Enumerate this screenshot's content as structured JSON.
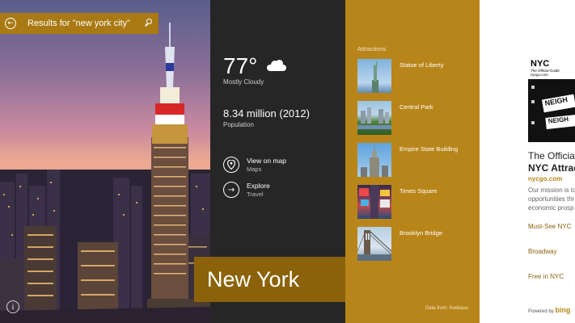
{
  "search": {
    "results_label": "Results for \"new york city\""
  },
  "info": {
    "temperature": "77°",
    "condition": "Mostly Cloudy",
    "population_value": "8.34 million (2012)",
    "population_label": "Population",
    "actions": [
      {
        "label": "View on map",
        "sublabel": "Maps",
        "icon": "map-pin-icon"
      },
      {
        "label": "Explore",
        "sublabel": "Travel",
        "icon": "arrow-right-icon"
      }
    ]
  },
  "title": "New York",
  "attractions": {
    "heading": "Attractions",
    "items": [
      {
        "name": "Statue of Liberty"
      },
      {
        "name": "Central Park"
      },
      {
        "name": "Empire State Building"
      },
      {
        "name": "Times Square"
      },
      {
        "name": "Brooklyn Bridge"
      }
    ],
    "data_from": "Data from: freebase"
  },
  "web": {
    "card_logo": "NYC",
    "card_sub1": "The Official Guide",
    "card_sub2": "nycgo.com",
    "card_sign": "NEIGH",
    "card_sign2": "NEIGH",
    "title_line1": "The Official N",
    "title_line2": "NYC Attracti",
    "url": "nycgo.com",
    "desc_line1": "Our mission is to",
    "desc_line2": "opportunities thr",
    "desc_line3": "economic prosp",
    "links": [
      "Must-See NYC",
      "Broadway",
      "Free in NYC"
    ],
    "powered_by": "Powered by",
    "bing": "bing"
  },
  "colors": {
    "accent_gold": "#b8851a",
    "dark_gold": "#8b6209",
    "search_bar": "#a97913",
    "dark_panel": "#262626"
  }
}
